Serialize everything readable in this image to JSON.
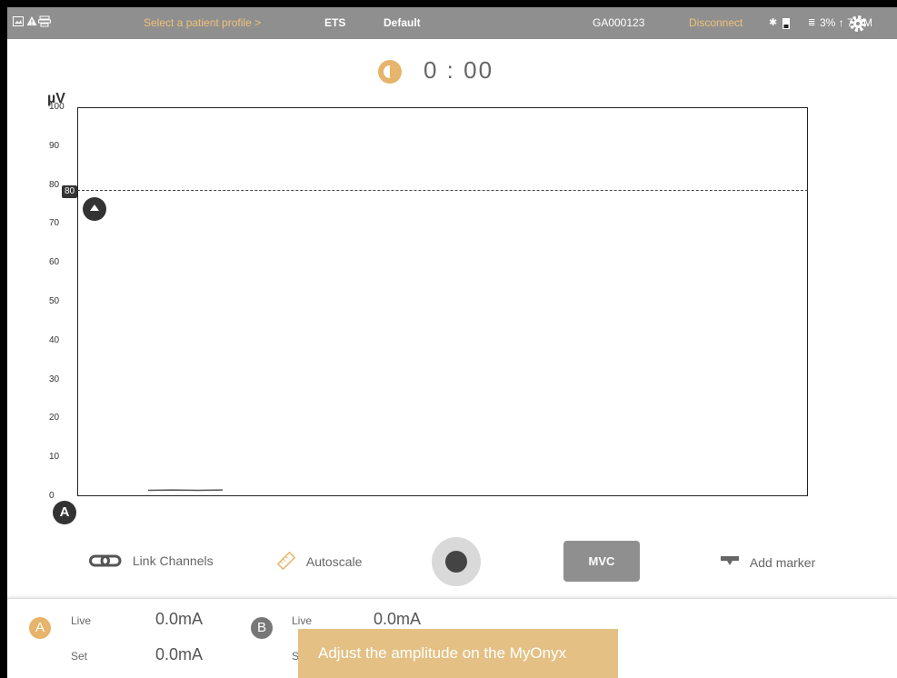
{
  "topbar": {
    "patient_profile": "Select a patient profile",
    "chevron": ">",
    "mode": "ETS",
    "protocol": "Default",
    "device_id": "GA000123",
    "disconnect": "Disconnect",
    "status_right": "3% ↑ 7 PM"
  },
  "timer": {
    "time": "0 : 00"
  },
  "chart": {
    "unit": "µV",
    "threshold_label": "80",
    "channel": "A"
  },
  "chart_data": {
    "type": "line",
    "ylabel": "µV",
    "ylim": [
      0,
      100
    ],
    "yticks": [
      "100",
      "90",
      "80",
      "70",
      "60",
      "50",
      "40",
      "30",
      "20",
      "10",
      "0"
    ],
    "threshold": 80,
    "series": [
      {
        "values": [
          2,
          2,
          2,
          2
        ]
      }
    ]
  },
  "toolbar": {
    "link_channels": "Link Channels",
    "autoscale": "Autoscale",
    "mvc": "MVC",
    "add_marker": "Add marker"
  },
  "channels": {
    "a": {
      "letter": "A",
      "live_label": "Live",
      "live_value": "0.0mA",
      "set_label": "Set",
      "set_value": "0.0mA"
    },
    "b": {
      "letter": "B",
      "live_label": "Live",
      "live_value": "0.0mA",
      "set_label": "S"
    }
  },
  "toast": {
    "message": "Adjust the amplitude on the MyOnyx"
  },
  "colors": {
    "accent": "#e6b46b",
    "bar": "#8f8f8f",
    "dark": "#333333"
  }
}
